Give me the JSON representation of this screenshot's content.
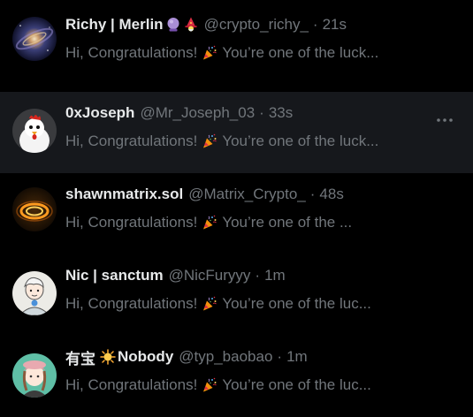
{
  "colors": {
    "background": "#000000",
    "hover_row": "#16181c",
    "primary_text": "#e7e9ea",
    "secondary_text": "#71767b"
  },
  "messages": [
    {
      "display_name": "Richy | Merlin",
      "name_emojis": [
        "crystal-ball-emoji",
        "wizard-emoji"
      ],
      "handle": "@crypto_richy_",
      "separator": "·",
      "time": "21s",
      "preview_before": "Hi, Congratulations!",
      "preview_emoji": "party-popper-emoji",
      "preview_after": "You’re one of the luck...",
      "avatar": "galaxy-avatar"
    },
    {
      "display_name": "0xJoseph",
      "handle": "@Mr_Joseph_03",
      "separator": "·",
      "time": "33s",
      "preview_before": "Hi, Congratulations!",
      "preview_emoji": "party-popper-emoji",
      "preview_after": "You’re one of the luck...",
      "avatar": "chicken-avatar",
      "more_icon": "more-options-icon"
    },
    {
      "display_name": "shawnmatrix.sol",
      "handle": "@Matrix_Crypto_",
      "separator": "·",
      "time": "48s",
      "preview_before": "Hi, Congratulations!",
      "preview_emoji": "party-popper-emoji",
      "preview_after": "You’re one of the ...",
      "avatar": "glowing-ring-avatar"
    },
    {
      "display_name": "Nic | sanctum",
      "handle": "@NicFuryyy",
      "separator": "·",
      "time": "1m",
      "preview_before": "Hi, Congratulations!",
      "preview_emoji": "party-popper-emoji",
      "preview_after": "You’re one of the luc...",
      "avatar": "cartoon-avatar"
    },
    {
      "display_name_prefix": "有宝",
      "name_emojis_pre": [
        "sun-emoji"
      ],
      "display_name": "Nobody",
      "handle": "@typ_baobao",
      "separator": "·",
      "time": "1m",
      "preview_before": "Hi, Congratulations!",
      "preview_emoji": "party-popper-emoji",
      "preview_after": "You’re one of the luc...",
      "avatar": "anime-girl-avatar"
    }
  ]
}
